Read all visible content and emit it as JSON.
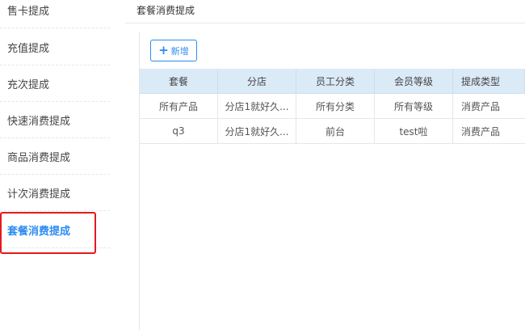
{
  "sidebar": {
    "items": [
      {
        "label": "售卡提成"
      },
      {
        "label": "充值提成"
      },
      {
        "label": "充次提成"
      },
      {
        "label": "快速消费提成"
      },
      {
        "label": "商品消费提成"
      },
      {
        "label": "计次消费提成"
      },
      {
        "label": "套餐消费提成"
      }
    ],
    "active_index": 6,
    "highlight_color": "#e4191d",
    "active_color": "#2d8cf0"
  },
  "panel": {
    "title": "套餐消费提成",
    "add_button": {
      "label": "新增",
      "icon": "plus-icon"
    }
  },
  "table": {
    "columns": [
      "套餐",
      "分店",
      "员工分类",
      "会员等级",
      "提成类型"
    ],
    "rows": [
      [
        "所有产品",
        "分店1就好久...",
        "所有分类",
        "所有等级",
        "消费产品"
      ],
      [
        "q3",
        "分店1就好久...",
        "前台",
        "test啦",
        "消费产品"
      ]
    ]
  }
}
